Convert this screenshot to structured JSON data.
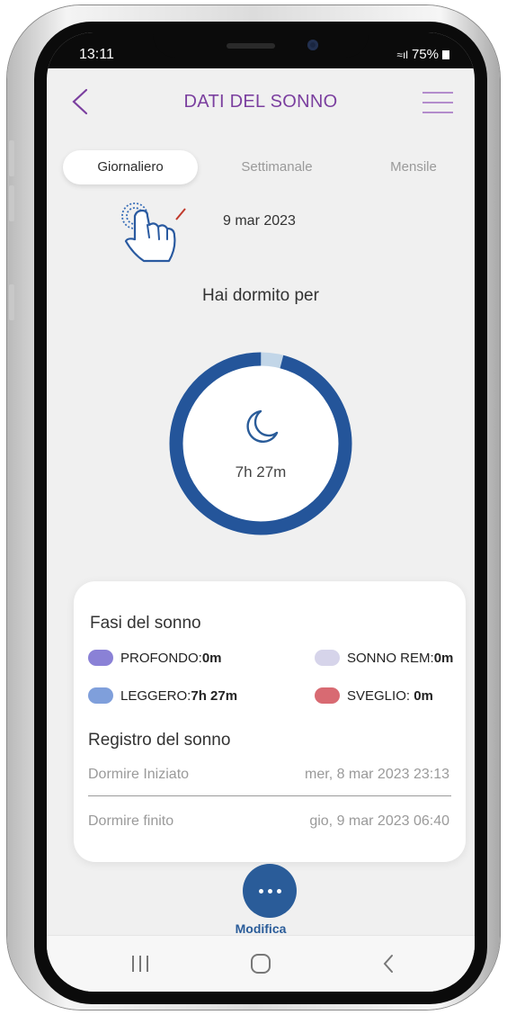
{
  "status_bar": {
    "time": "13:11",
    "signal": "§ᵗ.ııl",
    "battery": "75%"
  },
  "header": {
    "title": "DATI DEL SONNO"
  },
  "tabs": [
    {
      "label": "Giornaliero",
      "active": true
    },
    {
      "label": "Settimanale",
      "active": false
    },
    {
      "label": "Mensile",
      "active": false
    }
  ],
  "date": "9 mar 2023",
  "slept_label": "Hai dormito per",
  "ring": {
    "value": "7h 27m",
    "progress_fraction": 0.96,
    "color": "#24559a",
    "remainder_color": "#c2d6e8"
  },
  "phases": {
    "title": "Fasi del sonno",
    "items": [
      {
        "label": "PROFONDO:",
        "value": "0m",
        "color": "#8a81d6"
      },
      {
        "label": "SONNO REM:",
        "value": "0m",
        "color": "#d6d4ea"
      },
      {
        "label": "LEGGERO:",
        "value": "7h 27m",
        "color": "#7f9fdb"
      },
      {
        "label": "SVEGLIO: ",
        "value": "0m",
        "color": "#d86a72"
      }
    ]
  },
  "log": {
    "title": "Registro del sonno",
    "rows": [
      {
        "label": "Dormire Iniziato",
        "value": "mer, 8 mar 2023 23:13"
      },
      {
        "label": "Dormire finito",
        "value": "gio, 9 mar 2023 06:40"
      }
    ]
  },
  "action": {
    "label": "Modifica"
  },
  "icons": {
    "back": "chevron-left-icon",
    "menu": "hamburger-menu-icon",
    "swipe": "swipe-hand-icon",
    "moon": "moon-icon",
    "more": "more-dots-icon"
  }
}
